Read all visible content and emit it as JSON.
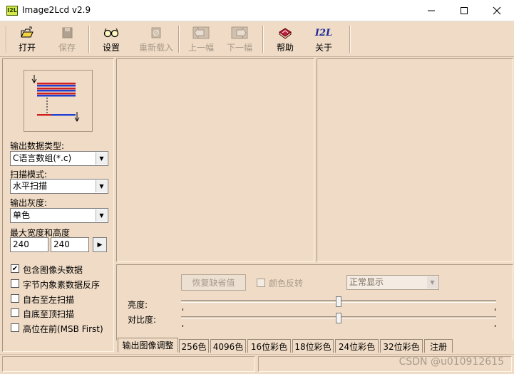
{
  "window": {
    "icon_text": "I2L",
    "title": "Image2Lcd v2.9"
  },
  "toolbar": {
    "open": "打开",
    "save": "保存",
    "settings": "设置",
    "reload": "重新载入",
    "prev": "上一幅",
    "next": "下一幅",
    "help": "帮助",
    "about": "关于",
    "about_icon_text": "I2L"
  },
  "left": {
    "output_type_label": "输出数据类型:",
    "output_type_value": "C语言数组(*.c)",
    "scan_mode_label": "扫描模式:",
    "scan_mode_value": "水平扫描",
    "gray_label": "输出灰度:",
    "gray_value": "单色",
    "size_label": "最大宽度和高度",
    "width_value": "240",
    "height_value": "240",
    "checkboxes": [
      {
        "label": "包含图像头数据",
        "checked": true
      },
      {
        "label": "字节内象素数据反序",
        "checked": false
      },
      {
        "label": "自右至左扫描",
        "checked": false
      },
      {
        "label": "自底至顶扫描",
        "checked": false
      },
      {
        "label": "高位在前(MSB First)",
        "checked": false
      }
    ]
  },
  "adjust": {
    "restore_label": "恢复缺省值",
    "invert_label": "颜色反转",
    "display_value": "正常显示",
    "brightness_label": "亮度:",
    "contrast_label": "对比度:",
    "brightness_level": 0.5,
    "contrast_level": 0.5
  },
  "tabs": [
    "输出图像调整",
    "256色",
    "4096色",
    "16位彩色",
    "18位彩色",
    "24位彩色",
    "32位彩色",
    "注册"
  ],
  "watermark": "CSDN @u010912615"
}
